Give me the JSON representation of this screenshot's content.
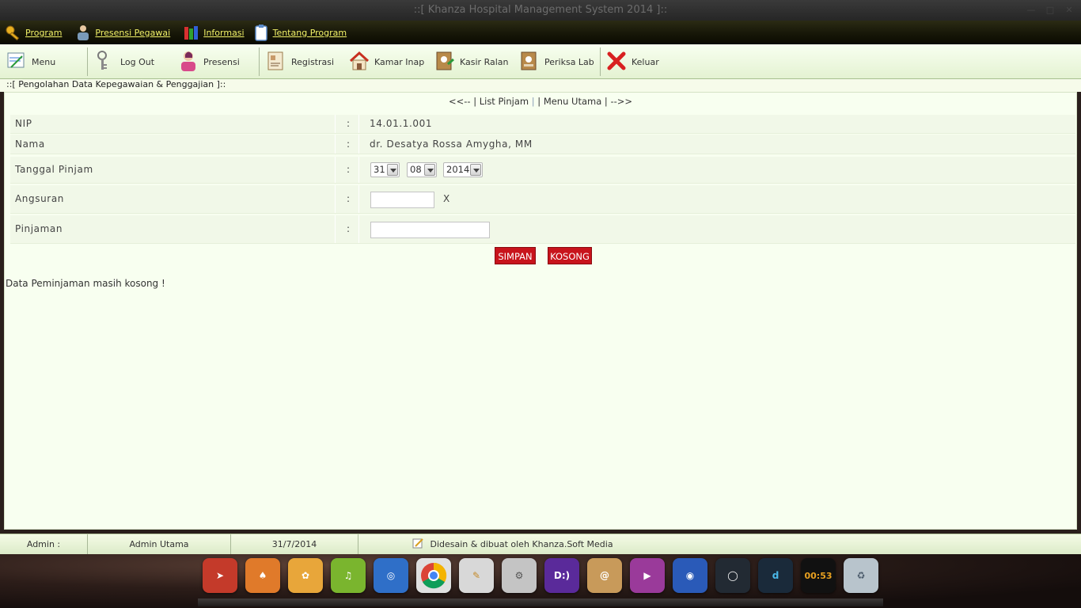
{
  "window": {
    "title": "::[ Khanza Hospital Management System 2014 ]::",
    "controls": [
      "minimize",
      "maximize",
      "close"
    ]
  },
  "menubar": {
    "items": [
      {
        "label": "Program",
        "icon": "key-icon"
      },
      {
        "label": "Presensi Pegawai",
        "icon": "employee-icon"
      },
      {
        "label": "Informasi",
        "icon": "info-books-icon"
      },
      {
        "label": "Tentang Program",
        "icon": "clipboard-icon"
      }
    ]
  },
  "toolbar": {
    "menu": "Menu",
    "logout": "Log Out",
    "presensi": "Presensi",
    "registrasi": "Registrasi",
    "kamar_inap": "Kamar Inap",
    "kasir_ralan": "Kasir Ralan",
    "periksa_lab": "Periksa Lab",
    "keluar": "Keluar"
  },
  "panel": {
    "caption": "::[ Pengolahan Data Kepegawaian & Penggajian ]::",
    "nav": {
      "prev": "<<--",
      "sep1": "|",
      "list_pinjam": "List Pinjam",
      "sep2": "|",
      "sep3": "|",
      "menu_utama": "Menu Utama",
      "sep4": "|",
      "next": "-->>"
    }
  },
  "form": {
    "colon": ":",
    "nip_label": "NIP",
    "nip_value": "14.01.1.001",
    "nama_label": "Nama",
    "nama_value": "dr. Desatya Rossa Amygha, MM",
    "tanggal_label": "Tanggal Pinjam",
    "tanggal_day": "31",
    "tanggal_month": "08",
    "tanggal_year": "2014",
    "angsuran_label": "Angsuran",
    "angsuran_value": "",
    "angsuran_suffix": "X",
    "pinjaman_label": "Pinjaman",
    "pinjaman_value": "",
    "simpan": "SIMPAN",
    "kosong": "KOSONG"
  },
  "message": "Data Peminjaman masih kosong !",
  "status": {
    "user_label": "Admin :",
    "user_value": "Admin Utama",
    "date": "31/7/2014",
    "credit": "Didesain & dibuat oleh Khanza.Soft Media"
  },
  "dock": {
    "clock": "00:53",
    "dict_label": "D:)",
    "colors": {
      "rocket": "#c43a2a",
      "cards": "#e07a2a",
      "swirl": "#e8a63a",
      "music": "#7ab52e",
      "globe_blue": "#2f6fc8",
      "chrome": "#e0e0e0",
      "notes": "#d8d8d8",
      "settings": "#c4c4c4",
      "dict": "#5a2a9a",
      "contacts": "#c89a5a",
      "video": "#9a3a9a",
      "earth": "#2a5ab8",
      "circle": "#222a33",
      "d_app": "#1a2a3a",
      "clock": "#111111",
      "trash": "#b8c4cc"
    }
  }
}
